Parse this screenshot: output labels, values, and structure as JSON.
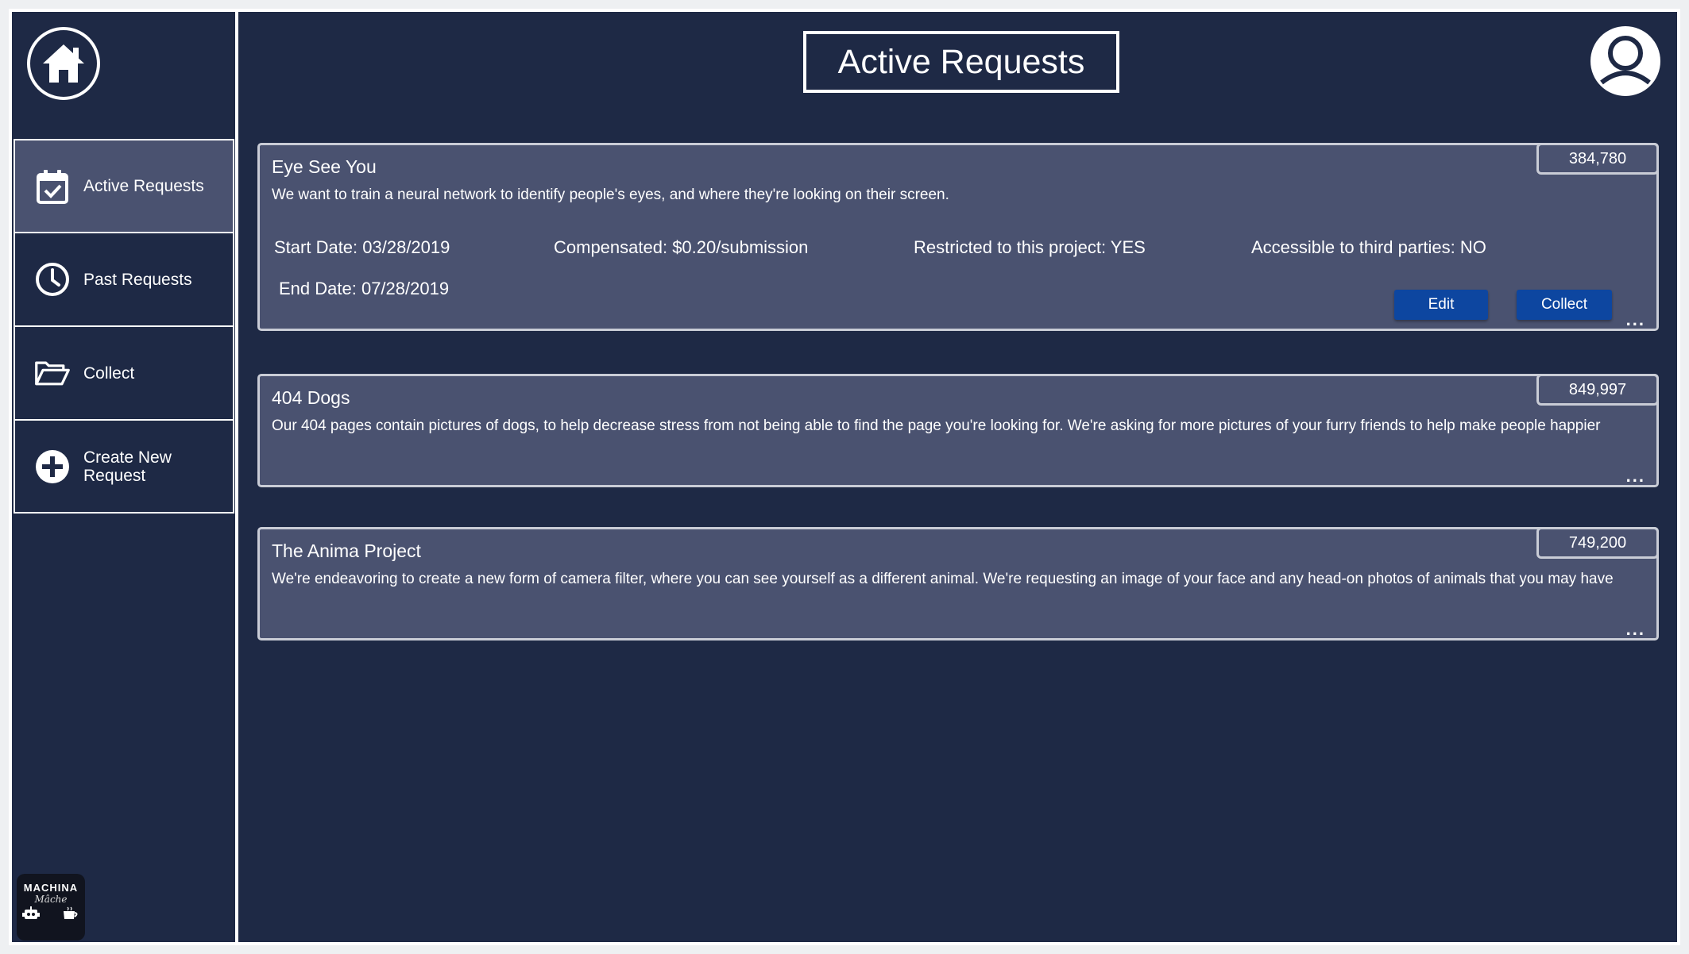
{
  "header": {
    "title": "Active Requests"
  },
  "sidebar": {
    "items": [
      {
        "label": "Active Requests",
        "icon": "calendar-check-icon"
      },
      {
        "label": "Past Requests",
        "icon": "clock-icon"
      },
      {
        "label": "Collect",
        "icon": "open-folder-icon"
      },
      {
        "label": "Create New Request",
        "icon": "plus-circle-icon"
      }
    ],
    "logo": {
      "line1": "MACHINA",
      "line2": "Mâche"
    }
  },
  "requests": [
    {
      "title": "Eye See You",
      "count": "384,780",
      "description": "We want to train a neural network to identify people's eyes, and where they're looking on their screen.",
      "start_date": "Start Date: 03/28/2019",
      "end_date": "End Date: 07/28/2019",
      "compensated": "Compensated: $0.20/submission",
      "restricted": "Restricted to this project: YES",
      "third_party": "Accessible to third parties: NO",
      "edit_label": "Edit",
      "collect_label": "Collect",
      "more": "..."
    },
    {
      "title": "404 Dogs",
      "count": "849,997",
      "description": "Our 404 pages contain pictures of dogs, to help decrease stress from not being able to find the page you're looking for. We're asking for more pictures of your furry friends to help make people happier",
      "more": "..."
    },
    {
      "title": "The Anima Project",
      "count": "749,200",
      "description": "We're endeavoring to create a new form of camera filter, where you can see yourself as a different animal. We're requesting an image of your face and any head-on photos of animals that you may have",
      "more": "..."
    }
  ],
  "colors": {
    "background": "#1e2945",
    "card": "#4a5270",
    "button": "#0d46a0",
    "border": "#ffffff"
  }
}
